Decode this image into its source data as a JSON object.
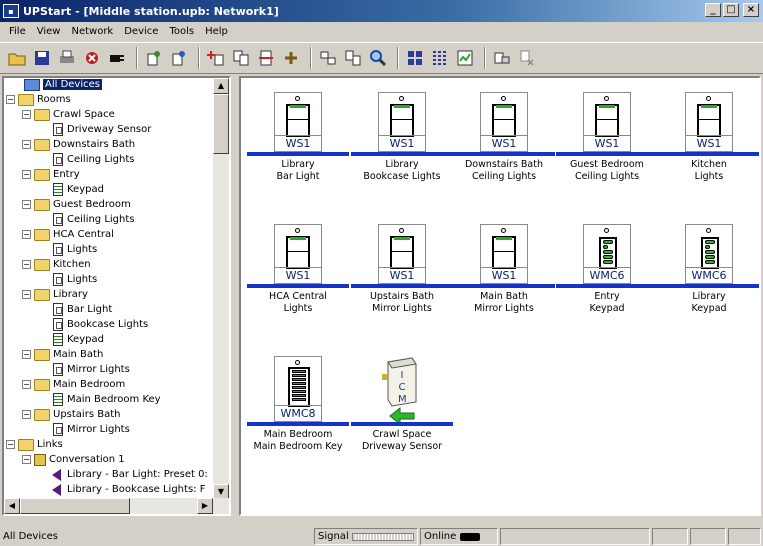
{
  "window": {
    "title": "UPStart - [Middle station.upb: Network1]"
  },
  "menu": [
    "File",
    "View",
    "Network",
    "Device",
    "Tools",
    "Help"
  ],
  "tree": {
    "nodes": [
      {
        "label": "All Devices",
        "selected": true
      },
      {
        "label": "Rooms"
      },
      {
        "label": "Crawl Space"
      },
      {
        "label": "Driveway Sensor"
      },
      {
        "label": "Downstairs Bath"
      },
      {
        "label": "Ceiling Lights"
      },
      {
        "label": "Entry"
      },
      {
        "label": "Keypad"
      },
      {
        "label": "Guest Bedroom"
      },
      {
        "label": "Ceiling Lights"
      },
      {
        "label": "HCA Central"
      },
      {
        "label": "Lights"
      },
      {
        "label": "Kitchen"
      },
      {
        "label": "Lights"
      },
      {
        "label": "Library"
      },
      {
        "label": "Bar Light"
      },
      {
        "label": "Bookcase Lights"
      },
      {
        "label": "Keypad"
      },
      {
        "label": "Main Bath"
      },
      {
        "label": "Mirror Lights"
      },
      {
        "label": "Main Bedroom"
      },
      {
        "label": "Main Bedroom Key"
      },
      {
        "label": "Upstairs Bath"
      },
      {
        "label": "Mirror Lights"
      },
      {
        "label": "Links"
      },
      {
        "label": "Conversation 1"
      },
      {
        "label": "Library - Bar Light: Preset 0:"
      },
      {
        "label": "Library - Bookcase Lights: F"
      }
    ]
  },
  "devices": [
    {
      "model": "WS1",
      "room": "Library",
      "name": "Bar Light"
    },
    {
      "model": "WS1",
      "room": "Library",
      "name": "Bookcase Lights"
    },
    {
      "model": "WS1",
      "room": "Downstairs Bath",
      "name": "Ceiling Lights"
    },
    {
      "model": "WS1",
      "room": "Guest Bedroom",
      "name": "Ceiling Lights"
    },
    {
      "model": "WS1",
      "room": "Kitchen",
      "name": "Lights"
    },
    {
      "model": "WS1",
      "room": "HCA Central",
      "name": "Lights"
    },
    {
      "model": "WS1",
      "room": "Upstairs Bath",
      "name": "Mirror Lights"
    },
    {
      "model": "WS1",
      "room": "Main Bath",
      "name": "Mirror Lights"
    },
    {
      "model": "WMC6",
      "room": "Entry",
      "name": "Keypad"
    },
    {
      "model": "WMC6",
      "room": "Library",
      "name": "Keypad"
    },
    {
      "model": "WMC8",
      "room": "Main Bedroom",
      "name": "Main Bedroom Key"
    },
    {
      "model": "",
      "room": "Crawl Space",
      "name": "Driveway Sensor",
      "icm_label": "ICM"
    }
  ],
  "status": {
    "left": "All Devices",
    "signal_label": "Signal",
    "online_label": "Online"
  },
  "colors": {
    "titlebar": "#0a246a",
    "device_bar": "#1533c8",
    "led_green": "#2aa82a"
  }
}
